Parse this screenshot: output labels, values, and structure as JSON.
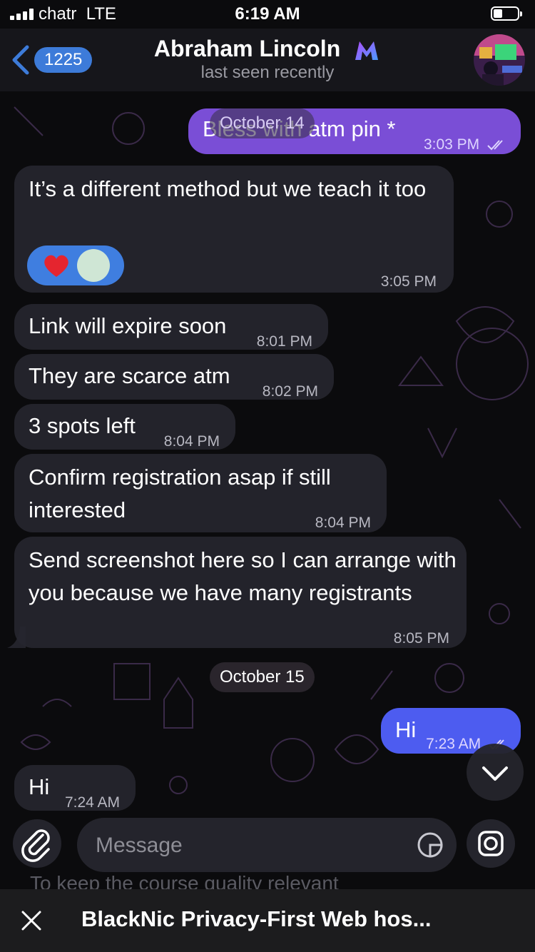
{
  "status_bar": {
    "carrier": "chatr",
    "network": "LTE",
    "time": "6:19 AM"
  },
  "header": {
    "unread_count": "1225",
    "contact_name": "Abraham Lincoln",
    "status": "last seen recently"
  },
  "messages": [
    {
      "text": "Bless with atm pin *",
      "time": "3:03 PM",
      "direction": "outgoing",
      "date_overlay": "October 14"
    },
    {
      "text": "It’s a different method but we teach it too",
      "time": "3:05 PM",
      "direction": "incoming",
      "reactions": [
        "heart",
        "sticker"
      ]
    },
    {
      "text": "Link will expire soon",
      "time": "8:01 PM",
      "direction": "incoming"
    },
    {
      "text": "They are scarce atm",
      "time": "8:02 PM",
      "direction": "incoming"
    },
    {
      "text": "3 spots left",
      "time": "8:04 PM",
      "direction": "incoming"
    },
    {
      "text": "Confirm registration asap if still interested",
      "time": "8:04 PM",
      "direction": "incoming"
    },
    {
      "text": "Send screenshot here so I can arrange with you because we have many registrants",
      "time": "8:05 PM",
      "direction": "incoming"
    },
    {
      "text": "Hi",
      "time": "7:23 AM",
      "direction": "outgoing"
    },
    {
      "text": "Hi",
      "time": "7:24 AM",
      "direction": "incoming"
    }
  ],
  "date_separator": "October 15",
  "composer": {
    "placeholder": "Message"
  },
  "ghost_text": "To keep the course quality relevant",
  "banner": {
    "text": "BlackNic Privacy-First Web hos..."
  },
  "colors": {
    "outgoing_purple": "#7a4ed6",
    "outgoing_blue": "#4d5cf0",
    "incoming": "#26262e",
    "accent": "#3d7bd9"
  },
  "icons": [
    "back-chevron-icon",
    "paperclip-icon",
    "sticker-icon",
    "camera-icon",
    "chevron-down-icon",
    "close-icon",
    "heart-icon"
  ]
}
